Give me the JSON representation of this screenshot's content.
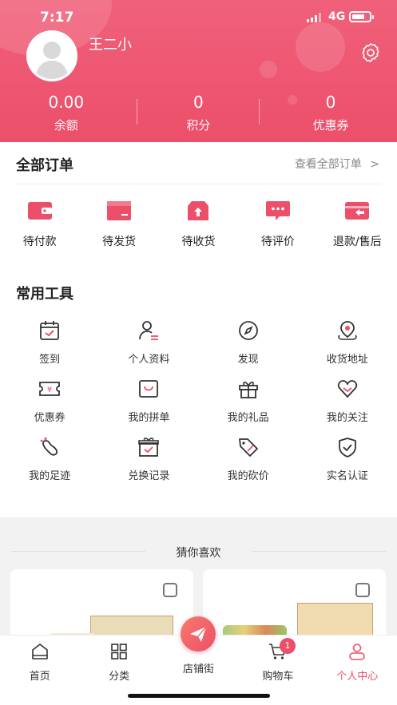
{
  "status_bar": {
    "time": "7:17",
    "network": "4G"
  },
  "profile": {
    "username": "王二小"
  },
  "stats": [
    {
      "value": "0.00",
      "label": "余额"
    },
    {
      "value": "0",
      "label": "积分"
    },
    {
      "value": "0",
      "label": "优惠券"
    }
  ],
  "orders": {
    "title": "全部订单",
    "view_all": "查看全部订单",
    "items": [
      {
        "label": "待付款",
        "icon": "wallet-icon"
      },
      {
        "label": "待发货",
        "icon": "box-icon"
      },
      {
        "label": "待收货",
        "icon": "receive-box-icon"
      },
      {
        "label": "待评价",
        "icon": "comment-icon"
      },
      {
        "label": "退款/售后",
        "icon": "refund-icon"
      }
    ]
  },
  "tools": {
    "title": "常用工具",
    "items": [
      {
        "label": "签到",
        "icon": "calendar-check-icon"
      },
      {
        "label": "个人资料",
        "icon": "user-profile-icon"
      },
      {
        "label": "发现",
        "icon": "compass-icon"
      },
      {
        "label": "收货地址",
        "icon": "location-icon"
      },
      {
        "label": "优惠券",
        "icon": "coupon-icon"
      },
      {
        "label": "我的拼单",
        "icon": "group-buy-icon"
      },
      {
        "label": "我的礼品",
        "icon": "gift-icon"
      },
      {
        "label": "我的关注",
        "icon": "heart-icon"
      },
      {
        "label": "我的足迹",
        "icon": "footprint-icon"
      },
      {
        "label": "兑换记录",
        "icon": "exchange-icon"
      },
      {
        "label": "我的砍价",
        "icon": "price-tag-icon"
      },
      {
        "label": "实名认证",
        "icon": "shield-check-icon"
      }
    ]
  },
  "recommend": {
    "title": "猜你喜欢"
  },
  "tabbar": {
    "items": [
      {
        "label": "首页",
        "icon": "home-icon"
      },
      {
        "label": "分类",
        "icon": "category-icon"
      },
      {
        "label": "店铺街",
        "icon": "send-icon"
      },
      {
        "label": "购物车",
        "icon": "cart-icon",
        "badge": "1"
      },
      {
        "label": "个人中心",
        "icon": "person-icon",
        "active": true
      }
    ]
  },
  "colors": {
    "accent": "#ec4f6a",
    "header_bg": "#f0607a"
  }
}
